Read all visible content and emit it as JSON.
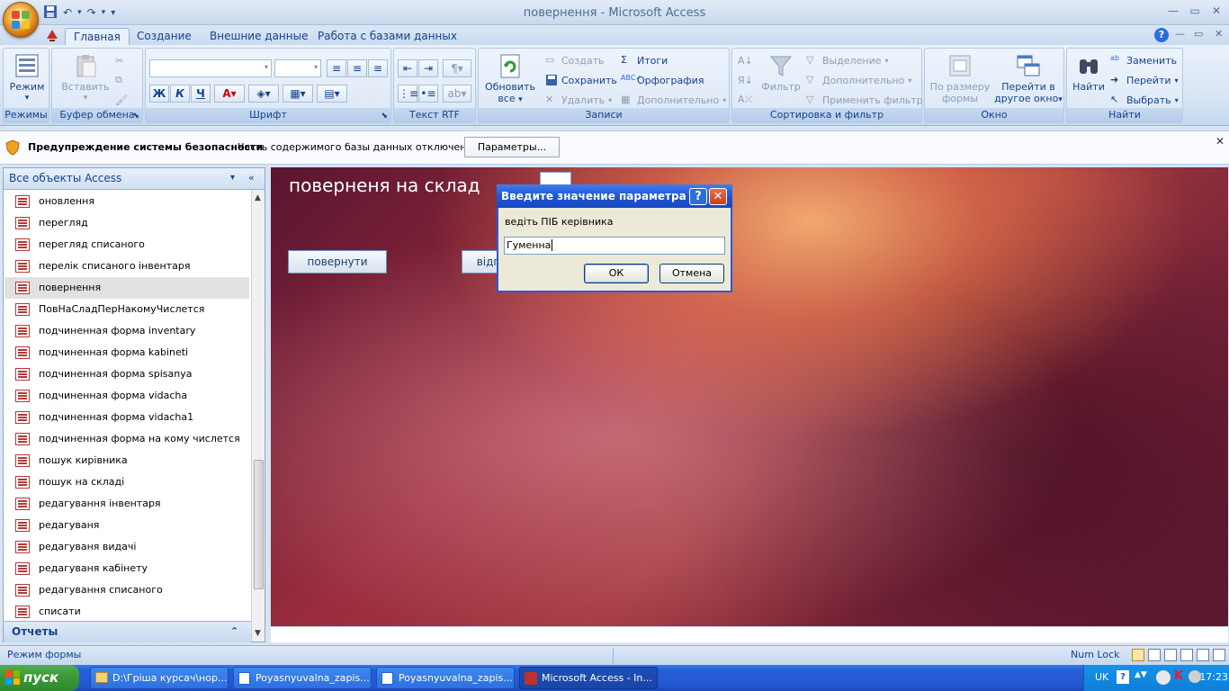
{
  "window": {
    "title": "повернення - Microsoft Access"
  },
  "tabs": [
    "Главная",
    "Создание",
    "Внешние данные",
    "Работа с базами данных"
  ],
  "ribbon": {
    "groups": {
      "modes": "Режимы",
      "clipboard": "Буфер обмена",
      "font": "Шрифт",
      "rtf": "Текст RTF",
      "records": "Записи",
      "sort": "Сортировка и фильтр",
      "window": "Окно",
      "find": "Найти"
    },
    "mode_btn": "Режим",
    "paste_btn": "Вставить",
    "refresh_l1": "Обновить",
    "refresh_l2": "все",
    "create": "Создать",
    "save": "Сохранить",
    "delete": "Удалить",
    "totals": "Итоги",
    "spelling": "Орфография",
    "more": "Дополнительно",
    "filter": "Фильтр",
    "selection": "Выделение",
    "more_filter": "Дополнительно",
    "apply_filter": "Применить фильтр",
    "fit_l1": "По размеру",
    "fit_l2": "формы",
    "switch_l1": "Перейти в",
    "switch_l2": "другое окно",
    "find_btn": "Найти",
    "replace": "Заменить",
    "goto": "Перейти",
    "select": "Выбрать"
  },
  "security": {
    "title": "Предупреждение системы безопасности",
    "message": "Часть содержимого базы данных отключено",
    "button": "Параметры..."
  },
  "nav": {
    "header": "Все объекты Access",
    "items": [
      "оновлення",
      "перегляд",
      "перегляд списаного",
      "перелік списаного інвентаря",
      "повернення",
      "ПовНаСладПерНакомуЧислется",
      "подчиненная форма inventary",
      "подчиненная форма kabineti",
      "подчиненная форма spisanya",
      "подчиненная форма vidacha",
      "подчиненная форма vidacha1",
      "подчиненная форма на кому числется",
      "пошук кирівника",
      "пошук на складі",
      "редагування інвентаря",
      "редагуваня",
      "редагуваня видачі",
      "редагуваня кабінету",
      "редагування списаного",
      "списати"
    ],
    "footer": "Отчеты"
  },
  "form": {
    "title": "поверненя на склад",
    "btn_return": "повернути",
    "btn_partial": "відп"
  },
  "dialog": {
    "title": "Введите значение параметра",
    "prompt": "ведіть ПІБ керівника",
    "value": "Гуменна",
    "ok": "ОК",
    "cancel": "Отмена"
  },
  "status": {
    "left": "Режим формы",
    "numlock": "Num Lock"
  },
  "taskbar": {
    "start": "пуск",
    "items": [
      "D:\\Гріша курсач\\нор...",
      "Poyasnyuvalna_zapis...",
      "Poyasnyuvalna_zapis...",
      "Microsoft Access - In..."
    ],
    "lang": "UK",
    "time": "17:23"
  }
}
